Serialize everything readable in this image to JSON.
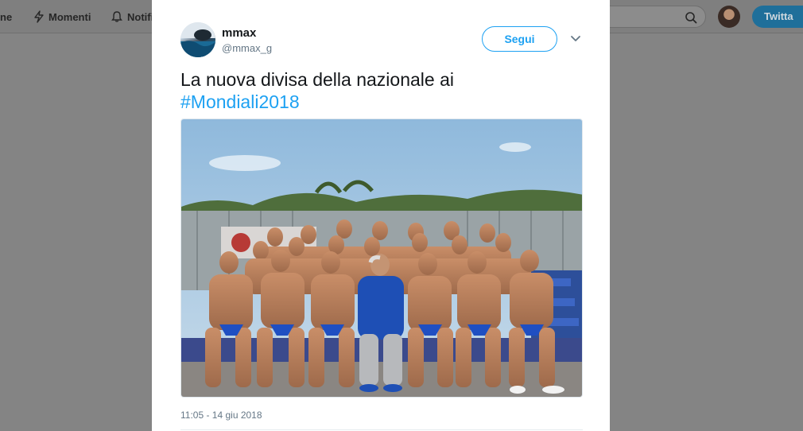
{
  "nav": {
    "home_partial": "ne",
    "moments": "Momenti",
    "notifications_partial": "Notifi",
    "search_partial": "8",
    "tweet_button": "Twitta"
  },
  "tweet": {
    "author_name": "mmax",
    "author_handle": "@mmax_g",
    "follow_label": "Segui",
    "text_plain": "La nuova divisa della nazionale ai",
    "hashtag": "#Mondiali2018",
    "timestamp": "11:05 - 14 giu 2018",
    "media_icon": "team-photo"
  },
  "colors": {
    "accent": "#1da1f2",
    "overlay": "#848484",
    "text": "#14171a",
    "muted": "#657786"
  }
}
